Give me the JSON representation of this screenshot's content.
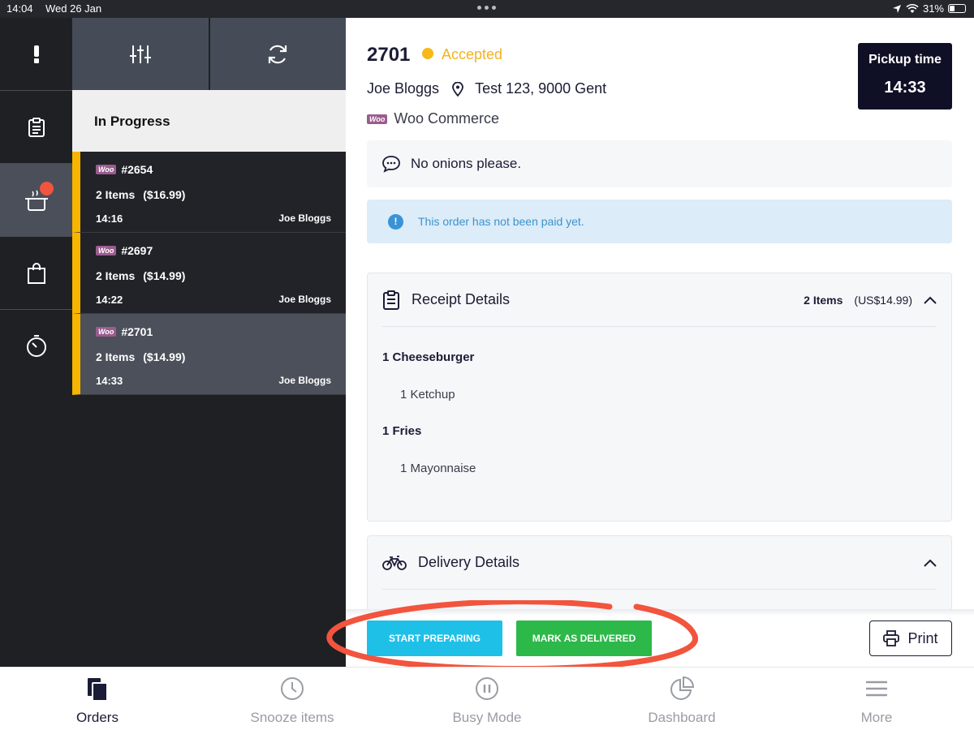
{
  "status_bar": {
    "time": "14:04",
    "date": "Wed 26 Jan",
    "battery": "31%",
    "battery_level": 0.31
  },
  "rail": {
    "items": [
      {
        "icon": "exclamation-icon"
      },
      {
        "icon": "clipboard-icon"
      },
      {
        "icon": "cooking-pot-icon",
        "active": true,
        "badge": true
      },
      {
        "icon": "shopping-bag-icon"
      },
      {
        "icon": "timer-icon"
      }
    ]
  },
  "list": {
    "toolbar": [
      {
        "icon": "filter-sliders-icon"
      },
      {
        "icon": "refresh-icon"
      }
    ],
    "section_title": "In Progress",
    "orders": [
      {
        "source": "Woo",
        "number": "#2654",
        "items": "2 Items",
        "price": "($16.99)",
        "time": "14:16",
        "customer": "Joe Bloggs",
        "selected": false
      },
      {
        "source": "Woo",
        "number": "#2697",
        "items": "2 Items",
        "price": "($14.99)",
        "time": "14:22",
        "customer": "Joe Bloggs",
        "selected": false
      },
      {
        "source": "Woo",
        "number": "#2701",
        "items": "2 Items",
        "price": "($14.99)",
        "time": "14:33",
        "customer": "Joe Bloggs",
        "selected": true
      }
    ]
  },
  "detail": {
    "order_number": "2701",
    "status": "Accepted",
    "customer": "Joe Bloggs",
    "address": "Test 123, 9000 Gent",
    "source_badge": "Woo",
    "source": "Woo Commerce",
    "pickup_label": "Pickup time",
    "pickup_time": "14:33",
    "note": "No onions please.",
    "alert": "This order has not been paid yet.",
    "alert_icon": "!",
    "receipt": {
      "title": "Receipt Details",
      "count": "2 Items",
      "total": "(US$14.99)",
      "lines": [
        {
          "text": "1 Cheeseburger",
          "kind": "main"
        },
        {
          "text": "1 Ketchup",
          "kind": "sub"
        },
        {
          "text": "1 Fries",
          "kind": "main"
        },
        {
          "text": "1 Mayonnaise",
          "kind": "sub"
        }
      ]
    },
    "delivery": {
      "title": "Delivery Details"
    },
    "actions": {
      "start": "START PREPARING",
      "deliver": "MARK AS DELIVERED",
      "print": "Print"
    }
  },
  "tabbar": {
    "tabs": [
      {
        "label": "Orders",
        "icon": "orders-icon",
        "active": true
      },
      {
        "label": "Snooze items",
        "icon": "clock-icon",
        "active": false
      },
      {
        "label": "Busy Mode",
        "icon": "pause-icon",
        "active": false
      },
      {
        "label": "Dashboard",
        "icon": "pie-chart-icon",
        "active": false
      },
      {
        "label": "More",
        "icon": "menu-icon",
        "active": false
      }
    ]
  },
  "colors": {
    "accent_yellow": "#f7b500",
    "start_button": "#1ec0e8",
    "deliver_button": "#2db84a",
    "annotation": "#f2543d"
  }
}
